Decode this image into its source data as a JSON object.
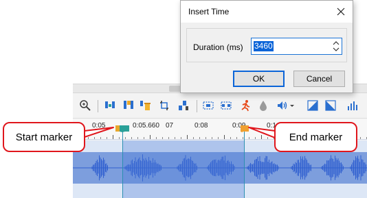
{
  "dialog": {
    "title": "Insert Time",
    "duration_label": "Duration (ms)",
    "duration_value": "3460",
    "ok_label": "OK",
    "cancel_label": "Cancel"
  },
  "ruler": {
    "labels": [
      "0:05",
      "0:05.660",
      "07",
      "0:08",
      "0:09",
      "0:1"
    ]
  },
  "callouts": {
    "start": "Start marker",
    "end": "End marker"
  },
  "toolbar": {
    "icons": [
      "zoom-icon",
      "insert-silence-icon",
      "paste-icon",
      "delete-icon",
      "crop-icon",
      "split-icon",
      "select-range-icon",
      "select-range-2-icon",
      "run-icon",
      "drop-icon",
      "volume-icon",
      "volume-dropdown-icon",
      "fade-in-icon",
      "fade-out-icon",
      "spectrum-icon"
    ]
  },
  "colors": {
    "callout_border": "#e0161c",
    "selection": "#4c78d6",
    "waveform": "#2f5fd0",
    "start_marker": "#2aa198",
    "end_marker": "#f0a030",
    "accent": "#0a64d8"
  }
}
